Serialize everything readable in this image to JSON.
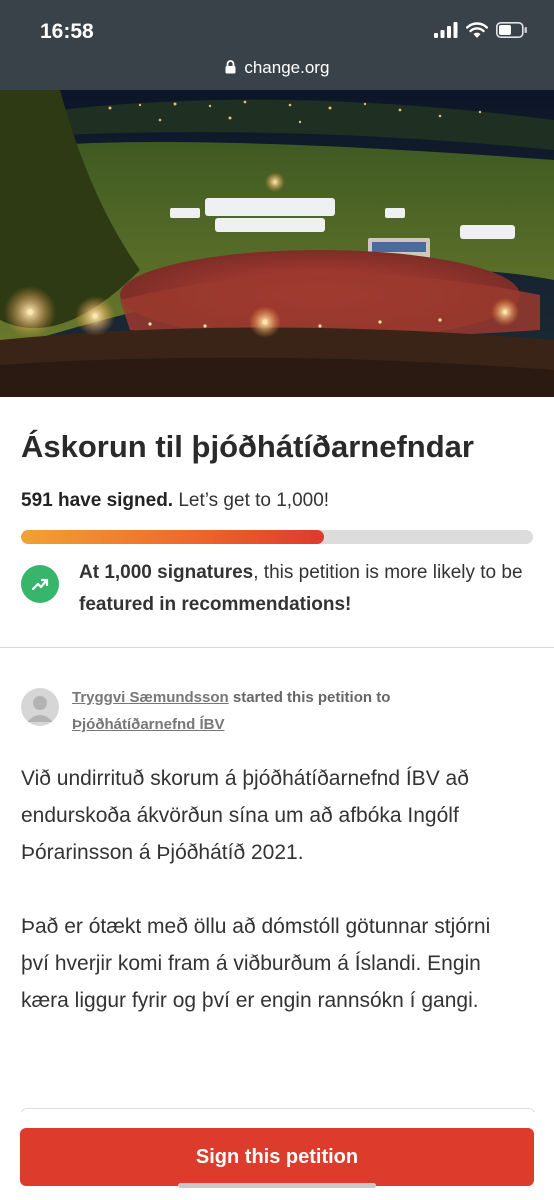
{
  "status_bar": {
    "time": "16:58",
    "url": "change.org"
  },
  "petition": {
    "title": "Áskorun til þjóðhátíðarnefndar",
    "signed_count": "591 have signed.",
    "goal_text": "Let’s get to 1,000!",
    "progress_fraction": 0.591,
    "milestone": {
      "bold_start": "At 1,000 signatures",
      "middle": ", this petition is more likely to be ",
      "bold_end": "featured in recommendations!"
    },
    "starter": {
      "name": "Tryggvi Sæmundsson",
      "action": " started this petition to ",
      "target": "Þjóðhátíðarnefnd ÍBV"
    },
    "body": [
      "Við undirrituð skorum á þjóðhátíðarnefnd ÍBV að endurskoða ákvörðun sína um að afbóka Ingólf Þórarinsson á Þjóðhátíð 2021.",
      "Það er ótækt með öllu að dómstóll götunnar stjórni því hverjir komi fram á viðburðum á Íslandi. Engin kæra liggur fyrir og því er engin rannsókn í gangi."
    ],
    "sign_button": "Sign this petition"
  },
  "colors": {
    "status_bar_bg": "#3a4249",
    "sign_button": "#dd3b2b",
    "milestone_icon": "#37b56b",
    "progress_start": "#f0a235",
    "progress_end": "#de3a2c"
  },
  "icons": {
    "signal": "cellular-signal-icon",
    "wifi": "wifi-icon",
    "battery": "battery-icon",
    "lock": "lock-icon",
    "milestone": "trending-up-icon",
    "avatar": "user-avatar-icon"
  }
}
